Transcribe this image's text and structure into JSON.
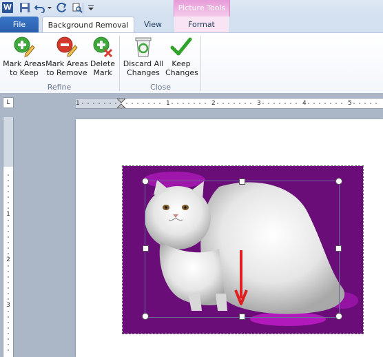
{
  "quick_access": {
    "app_icon_letter": "W",
    "items": [
      "save-icon",
      "undo-icon",
      "redo-icon",
      "print-preview-icon",
      "customize-icon"
    ]
  },
  "contextual_tab": {
    "title": "Picture Tools",
    "color": "#e79bd8"
  },
  "tabs": [
    {
      "label": "File",
      "active": false
    },
    {
      "label": "Background Removal",
      "active": true
    },
    {
      "label": "View",
      "active": false
    },
    {
      "label": "Format",
      "active": false
    }
  ],
  "ribbon": {
    "refine": {
      "label": "Refine",
      "buttons": [
        {
          "label_line1": "Mark Areas",
          "label_line2": "to Keep",
          "icon": "plus-pencil-icon"
        },
        {
          "label_line1": "Mark Areas",
          "label_line2": "to Remove",
          "icon": "minus-pencil-icon"
        },
        {
          "label_line1": "Delete",
          "label_line2": "Mark",
          "icon": "delete-mark-icon"
        }
      ]
    },
    "close": {
      "label": "Close",
      "buttons": [
        {
          "label_line1": "Discard All",
          "label_line2": "Changes",
          "icon": "recycle-bin-icon"
        },
        {
          "label_line1": "Keep",
          "label_line2": "Changes",
          "icon": "check-icon"
        }
      ]
    }
  },
  "ruler": {
    "horizontal_numbers": [
      "1",
      "1",
      "2",
      "3",
      "4",
      "5"
    ],
    "vertical_numbers": [
      "1",
      "2",
      "3"
    ]
  },
  "colors": {
    "removal_overlay": "#6a0d78",
    "arrow": "#e02020",
    "file_tab": "#2a5fad"
  }
}
